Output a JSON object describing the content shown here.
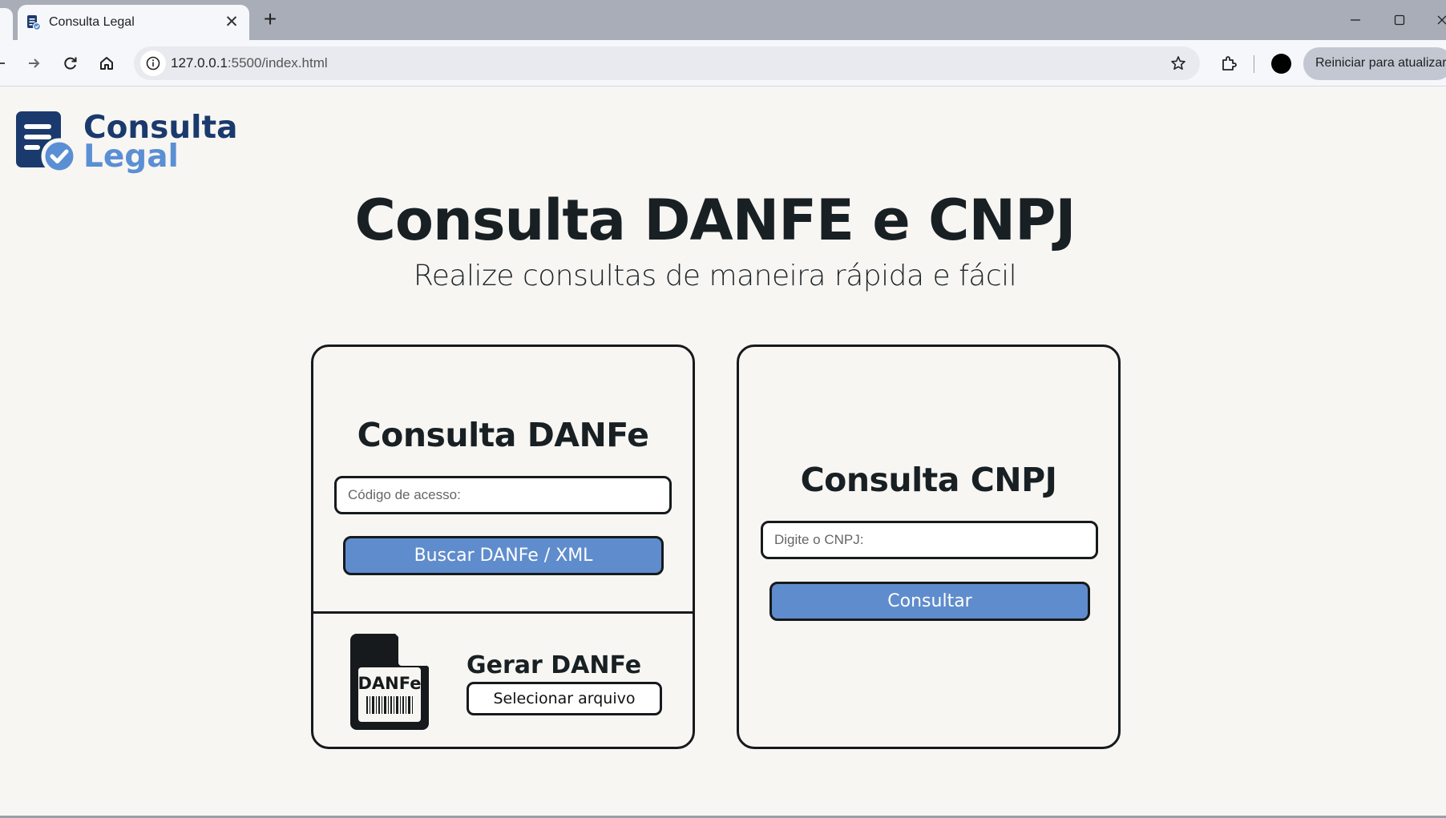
{
  "browser": {
    "tab_title": "Consulta Legal",
    "tab_close": "✕",
    "new_tab": "+",
    "url_host": "127.0.0.1",
    "url_path": ":5500/index.html",
    "update_button": "Reiniciar para atualizar"
  },
  "logo": {
    "line1": "Consulta",
    "line2": "Legal"
  },
  "hero": {
    "title": "Consulta DANFE e CNPJ",
    "subtitle": "Realize consultas de maneira rápida e fácil"
  },
  "danfe_card": {
    "title": "Consulta DANFe",
    "input_placeholder": "Código de acesso:",
    "search_button": "Buscar DANFe / XML",
    "file_icon_label": "DANFe",
    "generate_title": "Gerar DANFe",
    "select_file_button": "Selecionar arquivo"
  },
  "cnpj_card": {
    "title": "Consulta CNPJ",
    "input_placeholder": "Digite o CNPJ:",
    "submit_button": "Consultar"
  },
  "colors": {
    "brand_dark": "#1a3a6e",
    "brand_light": "#5b8fd4",
    "button_primary": "#5f8ccc",
    "page_background": "#f8f6f3"
  }
}
